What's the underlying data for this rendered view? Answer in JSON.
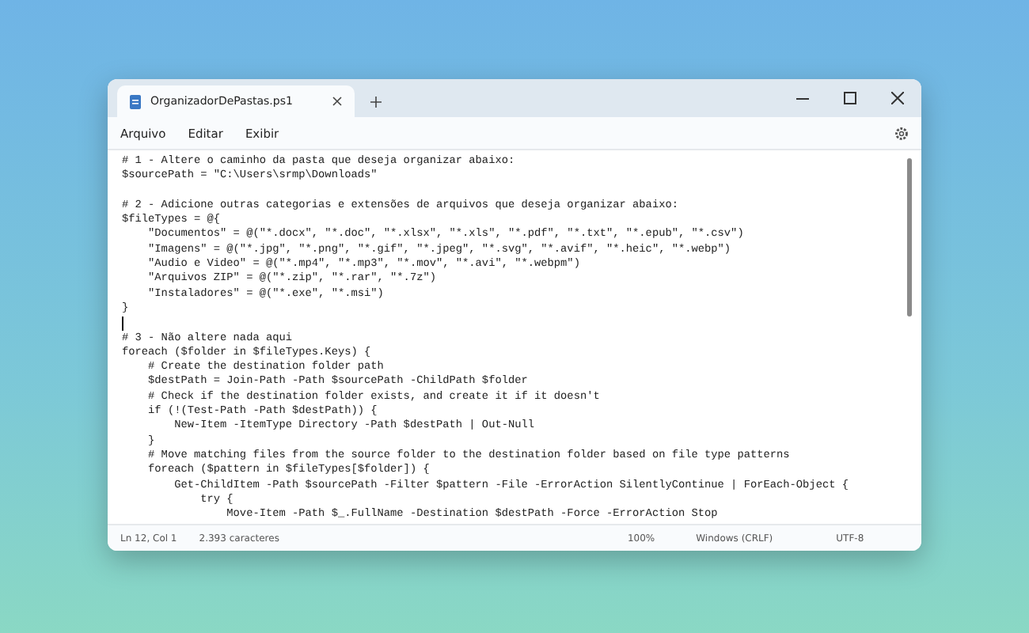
{
  "window": {
    "tabs": [
      {
        "label": "OrganizadorDePastas.ps1",
        "selected": true
      }
    ]
  },
  "menu": [
    "Arquivo",
    "Editar",
    "Exibir"
  ],
  "editor": {
    "lines": [
      {
        "text": "# 1 - Altere o caminho da pasta que deseja organizar abaixo:",
        "caret": false
      },
      {
        "text": "$sourcePath = \"C:\\Users\\srmp\\Downloads\"",
        "caret": false
      },
      {
        "caret": false
      },
      {
        "text": "# 2 - Adicione outras categorias e extensões de arquivos que deseja organizar abaixo:",
        "caret": false
      },
      {
        "text": "$fileTypes = @{",
        "caret": false
      },
      {
        "text": "    \"Documentos\" = @(\"*.docx\", \"*.doc\", \"*.xlsx\", \"*.xls\", \"*.pdf\", \"*.txt\", \"*.epub\", \"*.csv\")",
        "caret": false
      },
      {
        "text": "    \"Imagens\" = @(\"*.jpg\", \"*.png\", \"*.gif\", \"*.jpeg\", \"*.svg\", \"*.avif\", \"*.heic\", \"*.webp\")",
        "caret": false
      },
      {
        "text": "    \"Audio e Video\" = @(\"*.mp4\", \"*.mp3\", \"*.mov\", \"*.avi\", \"*.webpm\")",
        "caret": false
      },
      {
        "text": "    \"Arquivos ZIP\" = @(\"*.zip\", \"*.rar\", \"*.7z\")",
        "caret": false
      },
      {
        "text": "    \"Instaladores\" = @(\"*.exe\", \"*.msi\")",
        "caret": false
      },
      {
        "text": "}",
        "caret": false
      },
      {
        "caret": true
      },
      {
        "text": "# 3 - Não altere nada aqui",
        "caret": false
      },
      {
        "text": "foreach ($folder in $fileTypes.Keys) {",
        "caret": false
      },
      {
        "text": "    # Create the destination folder path",
        "caret": false
      },
      {
        "text": "    $destPath = Join-Path -Path $sourcePath -ChildPath $folder",
        "caret": false
      },
      {
        "text": "    # Check if the destination folder exists, and create it if it doesn't",
        "caret": false
      },
      {
        "text": "    if (!(Test-Path -Path $destPath)) {",
        "caret": false
      },
      {
        "text": "        New-Item -ItemType Directory -Path $destPath | Out-Null",
        "caret": false
      },
      {
        "text": "    }",
        "caret": false
      },
      {
        "text": "    # Move matching files from the source folder to the destination folder based on file type patterns",
        "caret": false
      },
      {
        "text": "    foreach ($pattern in $fileTypes[$folder]) {",
        "caret": false
      },
      {
        "text": "        Get-ChildItem -Path $sourcePath -Filter $pattern -File -ErrorAction SilentlyContinue | ForEach-Object {",
        "caret": false
      },
      {
        "text": "            try {",
        "caret": false
      },
      {
        "text": "                Move-Item -Path $_.FullName -Destination $destPath -Force -ErrorAction Stop",
        "caret": false
      }
    ]
  },
  "status_bar": {
    "position": "Ln 12, Col 1",
    "characters": "2.393 caracteres",
    "zoom": "100%",
    "line_endings": "Windows (CRLF)",
    "encoding": "UTF-8"
  }
}
